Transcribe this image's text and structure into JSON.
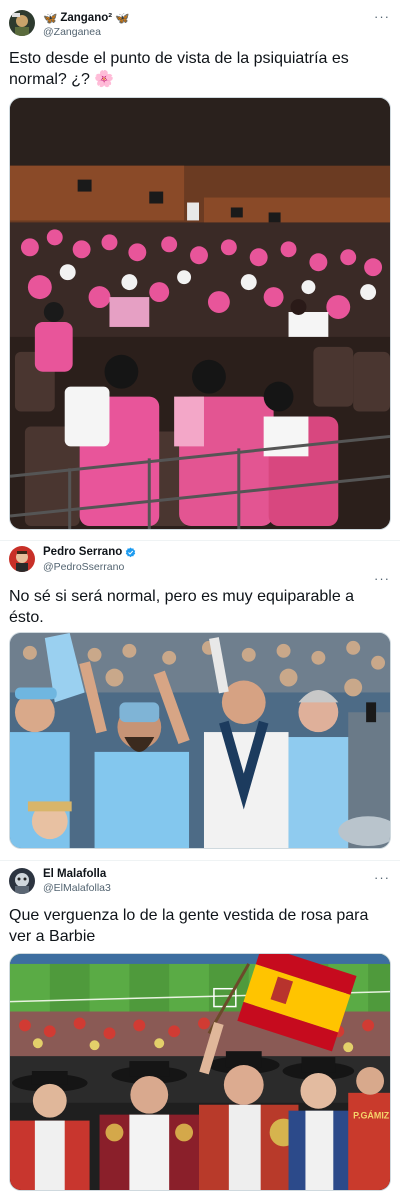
{
  "tweets": [
    {
      "name": "Zangano²",
      "name_emoji_left": "🦋",
      "name_emoji_right": "🦋",
      "handle": "@Zanganea",
      "text": "Esto desde el punto de vista de la psiquiatría es normal? ¿? 🌸",
      "more": "···",
      "verified": false,
      "media_description_icon": "cinema-photo"
    },
    {
      "name": "Pedro Serrano",
      "handle": "@PedroSserrano",
      "text": "No sé si será normal, pero es muy equiparable a ésto.",
      "more": "···",
      "verified": true,
      "verified_color": "#1d9bf0",
      "media_description_icon": "football-fans-photo"
    },
    {
      "name": "El Malafolla",
      "handle": "@ElMalafolla3",
      "text": "Que verguenza lo de la gente vestida de rosa para ver a Barbie",
      "more": "···",
      "verified": false,
      "media_description_icon": "stadium-fans-photo",
      "shirt_text": "P.GÁMIZ"
    }
  ],
  "colors": {
    "text": "#0f1419",
    "secondary": "#536471",
    "accent": "#1d9bf0"
  }
}
